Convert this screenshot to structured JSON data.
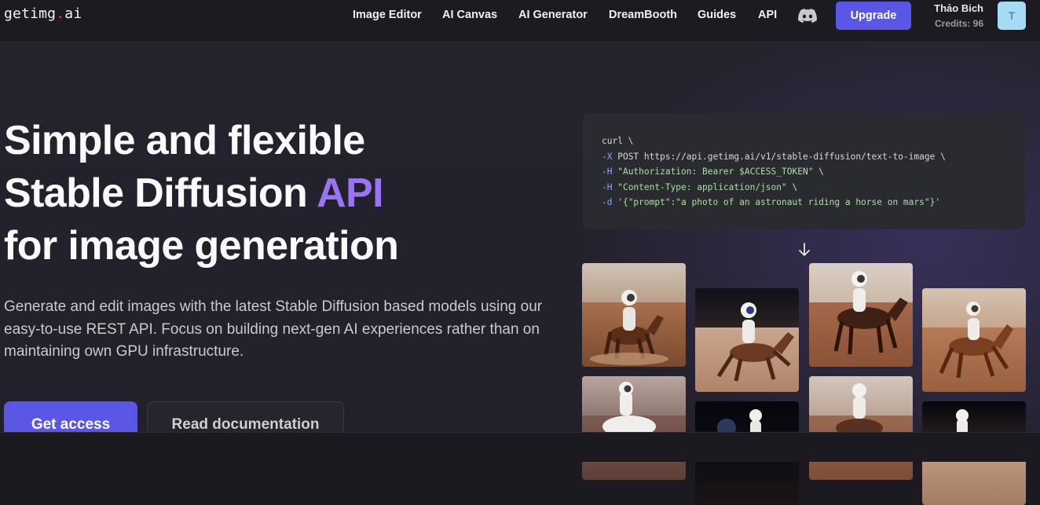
{
  "brand": {
    "logo_main": "getimg",
    "logo_dot": ".",
    "logo_tld": "ai"
  },
  "nav": {
    "links": [
      "Image Editor",
      "AI Canvas",
      "AI Generator",
      "DreamBooth",
      "Guides",
      "API"
    ],
    "upgrade_label": "Upgrade"
  },
  "user": {
    "name": "Thảo Bich",
    "credits": "Credits: 96",
    "avatar_initial": "T"
  },
  "hero": {
    "title_line1": "Simple and flexible",
    "title_line2_pre": "Stable Diffusion ",
    "title_line2_accent": "API",
    "title_line3": "for image generation",
    "description": "Generate and edit images with the latest Stable Diffusion based models using our easy-to-use REST API. Focus on building next-gen AI experiences rather than on maintaining own GPU infrastructure.",
    "primary_button": "Get access",
    "secondary_button": "Read documentation"
  },
  "code": {
    "line1": "curl \\",
    "line2_flag": "-X",
    "line2_rest": " POST https://api.getimg.ai/v1/stable-diffusion/text-to-image \\",
    "line3_flag": "-H",
    "line3_str": " \"Authorization: Bearer $ACCESS_TOKEN\"",
    "line3_end": " \\",
    "line4_flag": "-H",
    "line4_str": " \"Content-Type: application/json\"",
    "line4_end": " \\",
    "line5_flag": "-d",
    "line5_str": " '{\"prompt\":\"a photo of an astronaut riding a horse on mars\"}'"
  },
  "colors": {
    "accent": "#5b57e6",
    "accent_text": "#9b74f5",
    "background": "#24232c"
  },
  "icons": {
    "discord": "discord-icon",
    "arrow_down": "arrow-down-icon"
  }
}
